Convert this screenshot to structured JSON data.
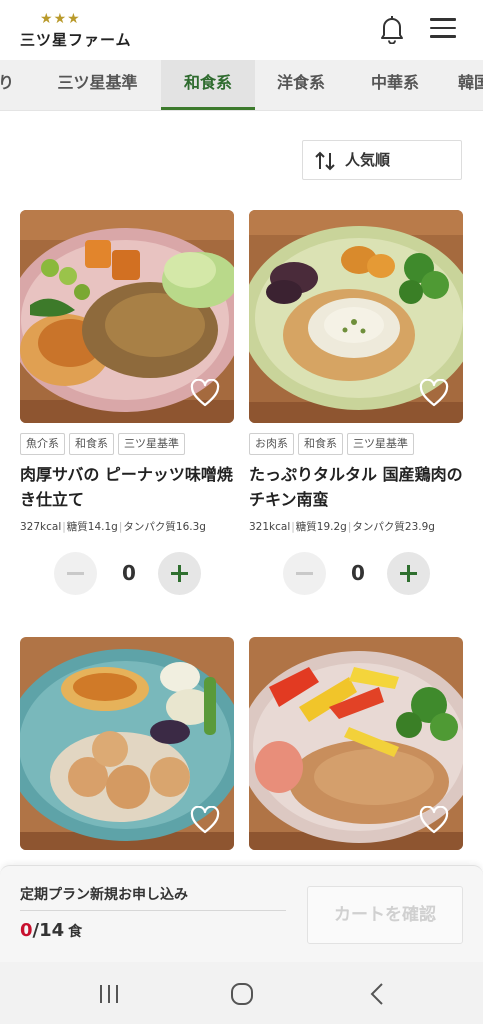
{
  "brand": {
    "logo_text": "三ツ星ファーム"
  },
  "tabs": [
    {
      "label": "り"
    },
    {
      "label": "三ツ星基準"
    },
    {
      "label": "和食系",
      "active": true
    },
    {
      "label": "洋食系"
    },
    {
      "label": "中華系"
    },
    {
      "label": "韓国"
    }
  ],
  "sort": {
    "label": "人気順"
  },
  "products": [
    {
      "tags": [
        "魚介系",
        "和食系",
        "三ツ星基準"
      ],
      "title": "肉厚サバの ピーナッツ味噌焼き仕立て",
      "kcal": "327kcal",
      "carbs": "糖質14.1g",
      "protein": "タンパク質16.3g",
      "quantity": "0"
    },
    {
      "tags": [
        "お肉系",
        "和食系",
        "三ツ星基準"
      ],
      "title": "たっぷりタルタル 国産鶏肉のチキン南蛮",
      "kcal": "321kcal",
      "carbs": "糖質19.2g",
      "protein": "タンパク質23.9g",
      "quantity": "0"
    },
    {
      "tags": [],
      "title": "",
      "quantity": ""
    },
    {
      "tags": [],
      "title": "",
      "quantity": ""
    }
  ],
  "cart": {
    "plan_label": "定期プラン新規お申し込み",
    "selected_count": "0",
    "total_count": "/14",
    "unit": "食",
    "confirm_label": "カートを確認"
  },
  "icons": {
    "bell": "bell-icon",
    "menu": "hamburger-menu-icon",
    "sort": "sort-arrows-icon",
    "heart": "heart-outline-icon",
    "nav_recent": "recent-apps-icon",
    "nav_home": "home-icon",
    "nav_back": "back-icon"
  },
  "colors": {
    "accent_green": "#3c7a2c",
    "count_red": "#c8102e",
    "star_gold": "#b99a2b"
  }
}
